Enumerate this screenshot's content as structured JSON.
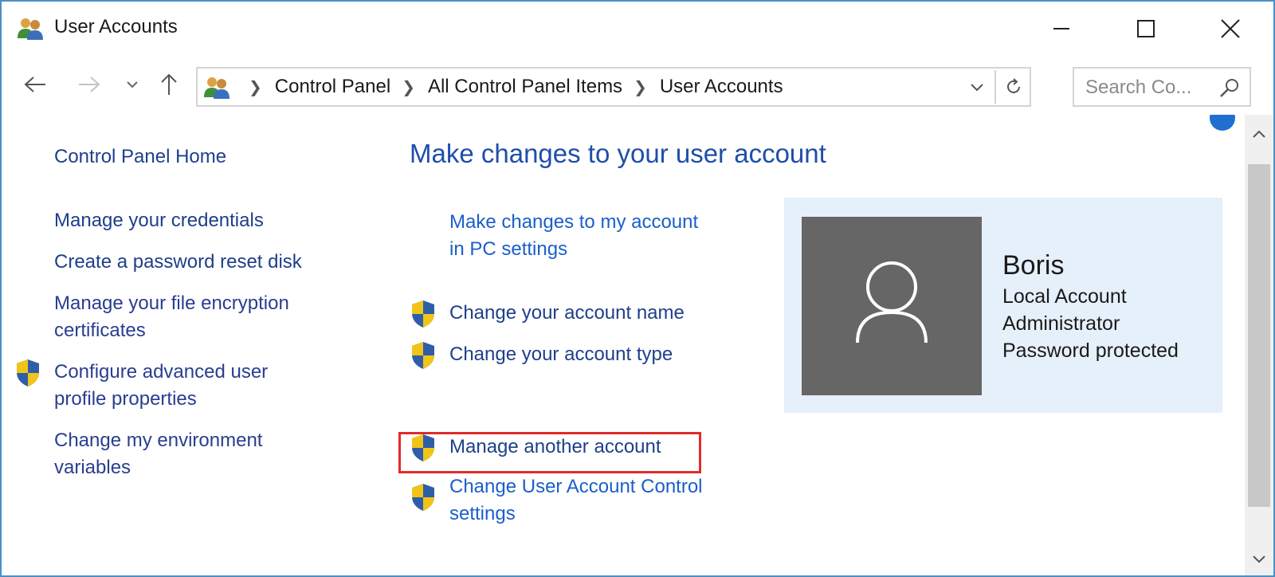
{
  "window": {
    "title": "User Accounts",
    "title_icon": "user-accounts-icon"
  },
  "navigation": {
    "breadcrumbs": [
      "Control Panel",
      "All Control Panel Items",
      "User Accounts"
    ],
    "search_placeholder": "Search Co..."
  },
  "left_pane": {
    "home": "Control Panel Home",
    "links": [
      {
        "lines": [
          "Manage your credentials"
        ],
        "shield": false
      },
      {
        "lines": [
          "Create a password reset disk"
        ],
        "shield": false
      },
      {
        "lines": [
          "Manage your file encryption",
          "certificates"
        ],
        "shield": false
      },
      {
        "lines": [
          "Configure advanced user",
          "profile properties"
        ],
        "shield": true
      },
      {
        "lines": [
          "Change my environment",
          "variables"
        ],
        "shield": false
      }
    ]
  },
  "main": {
    "heading": "Make changes to your user account",
    "actions": [
      {
        "lines": [
          "Make changes to my account",
          "in PC settings"
        ],
        "shield": false
      },
      {
        "lines": [
          "Change your account name"
        ],
        "shield": true
      },
      {
        "lines": [
          "Change your account type"
        ],
        "shield": true
      },
      {
        "lines": [
          "Manage another account"
        ],
        "shield": true,
        "highlighted": true
      },
      {
        "lines": [
          "Change User Account Control",
          "settings"
        ],
        "shield": true
      }
    ]
  },
  "user": {
    "name": "Boris",
    "account_type": "Local Account",
    "role": "Administrator",
    "password_status": "Password protected"
  },
  "colors": {
    "link": "#1a5fc9",
    "left_link": "#2a3d8f",
    "heading": "#1f4eaa",
    "highlight_border": "#e12b2b",
    "card_background": "#e6f0fa",
    "avatar_background": "#666666"
  }
}
